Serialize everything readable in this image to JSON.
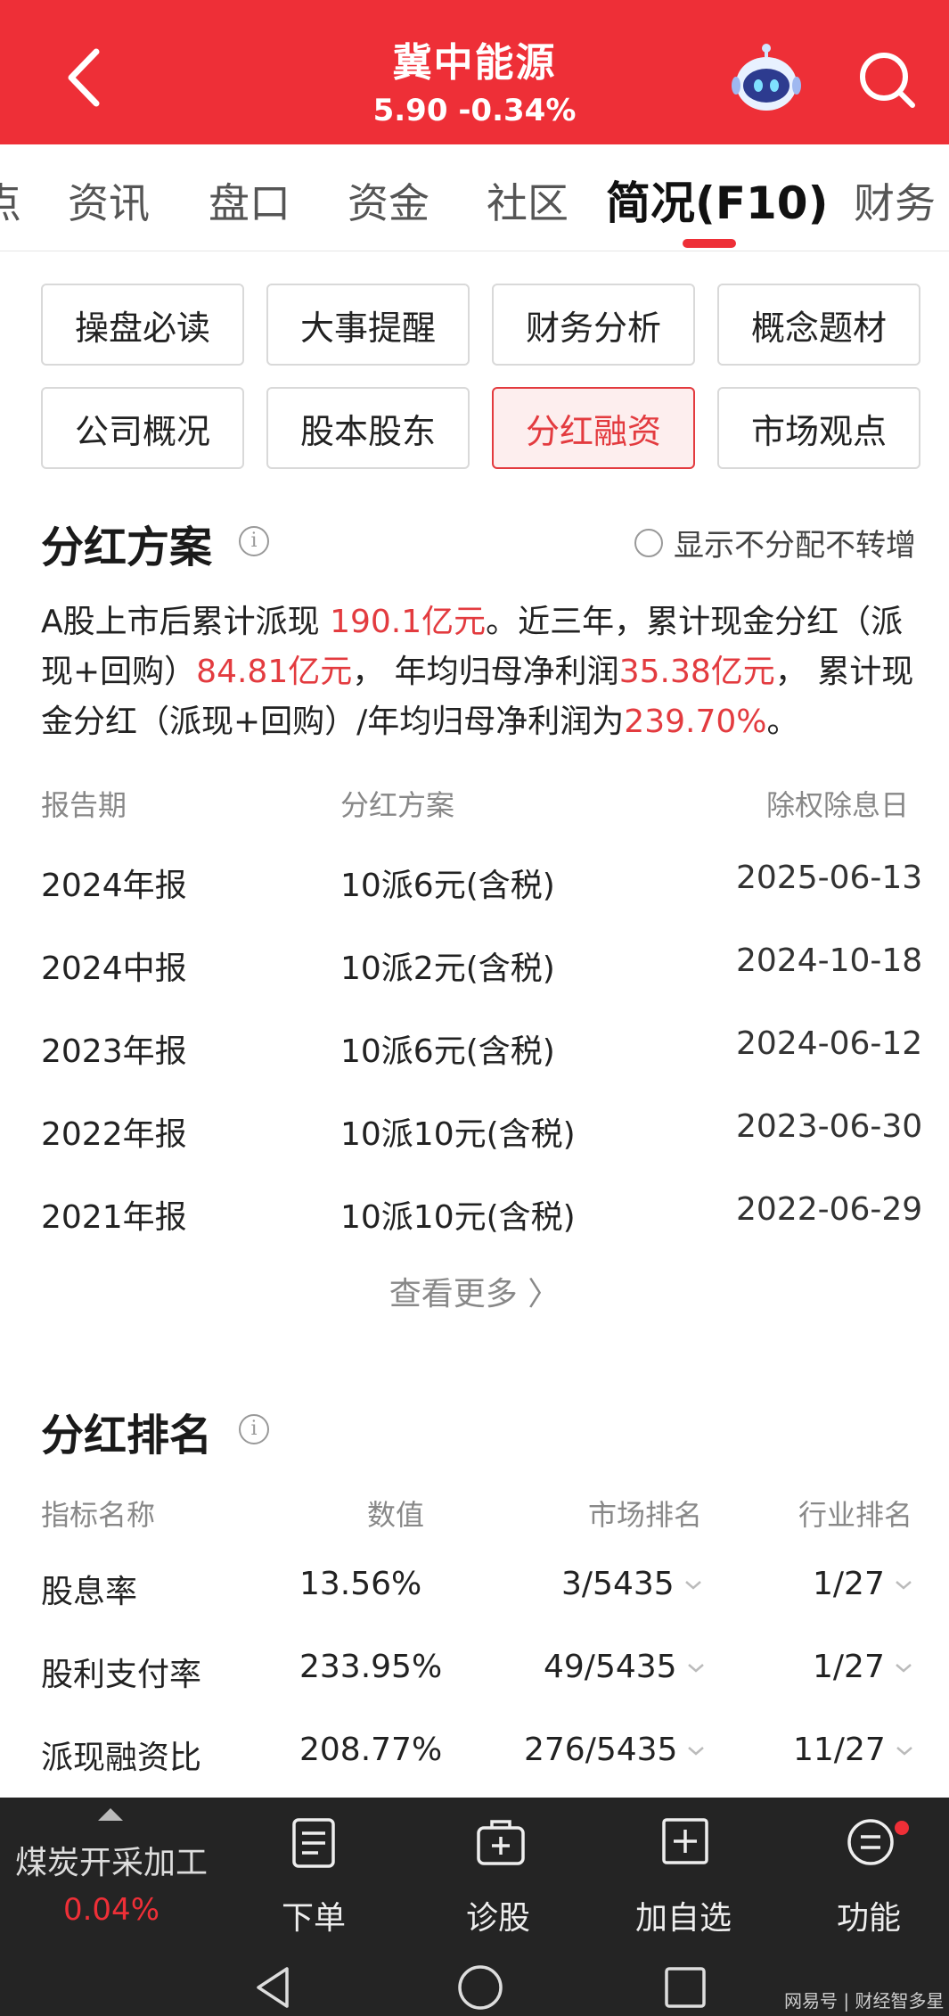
{
  "header": {
    "stock_name": "冀中能源",
    "price_line": "5.90 -0.34%",
    "bg_color": "#ee2f37"
  },
  "tabs": [
    {
      "label": "点"
    },
    {
      "label": "资讯"
    },
    {
      "label": "盘口"
    },
    {
      "label": "资金"
    },
    {
      "label": "社区"
    },
    {
      "label": "简况(F10)",
      "active": true
    },
    {
      "label": "财务"
    }
  ],
  "subnav": [
    {
      "label": "操盘必读"
    },
    {
      "label": "大事提醒"
    },
    {
      "label": "财务分析"
    },
    {
      "label": "概念题材"
    },
    {
      "label": "公司概况"
    },
    {
      "label": "股本股东"
    },
    {
      "label": "分红融资",
      "active": true
    },
    {
      "label": "市场观点"
    }
  ],
  "dividend_plan": {
    "title": "分红方案",
    "toggle_label": "显示不分配不转增",
    "summary": {
      "p1": "A股上市后累计派现 ",
      "v1": "190.1亿元",
      "p2": "。近三年，累计现金分红（派现+回购）",
      "v2": "84.81亿元",
      "p3": "， 年均归母净利润",
      "v3": "35.38亿元",
      "p4": "， 累计现金分红（派现+回购）/年均归母净利润为",
      "v4": "239.70%",
      "p5": "。"
    },
    "headers": {
      "period": "报告期",
      "plan": "分红方案",
      "exdate": "除权除息日"
    },
    "rows": [
      {
        "period": "2024年报",
        "plan": "10派6元(含税)",
        "exdate": "2025-06-13"
      },
      {
        "period": "2024中报",
        "plan": "10派2元(含税)",
        "exdate": "2024-10-18"
      },
      {
        "period": "2023年报",
        "plan": "10派6元(含税)",
        "exdate": "2024-06-12"
      },
      {
        "period": "2022年报",
        "plan": "10派10元(含税)",
        "exdate": "2023-06-30"
      },
      {
        "period": "2021年报",
        "plan": "10派10元(含税)",
        "exdate": "2022-06-29"
      }
    ],
    "more_label": "查看更多 〉"
  },
  "dividend_rank": {
    "title": "分红排名",
    "headers": {
      "name": "指标名称",
      "value": "数值",
      "market": "市场排名",
      "industry": "行业排名"
    },
    "rows": [
      {
        "name": "股息率",
        "value": "13.56%",
        "market": "3/5435",
        "industry": "1/27"
      },
      {
        "name": "股利支付率",
        "value": "233.95%",
        "market": "49/5435",
        "industry": "1/27"
      },
      {
        "name": "派现融资比",
        "value": "208.77%",
        "market": "276/5435",
        "industry": "11/27"
      }
    ]
  },
  "toolbar": {
    "industry_name": "煤炭开采加工",
    "industry_pct": "0.04%",
    "items": [
      {
        "label": "下单",
        "icon": "order-icon"
      },
      {
        "label": "诊股",
        "icon": "diagnose-icon"
      },
      {
        "label": "加自选",
        "icon": "add-watchlist-icon"
      },
      {
        "label": "功能",
        "icon": "menu-icon"
      }
    ]
  },
  "watermark": "网易号 | 财经智多星"
}
